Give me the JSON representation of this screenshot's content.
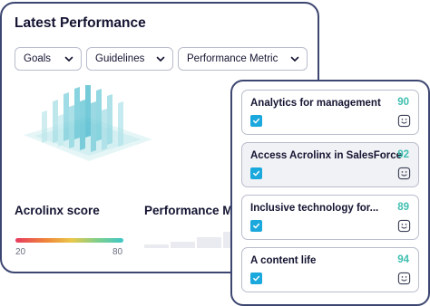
{
  "performance": {
    "title": "Latest Performance",
    "filters": [
      {
        "label": "Goals"
      },
      {
        "label": "Guidelines"
      },
      {
        "label": "Performance Metric"
      }
    ],
    "score": {
      "label": "Acrolinx score",
      "min": "20",
      "max": "80"
    },
    "metric_label": "Performance Me"
  },
  "items": [
    {
      "title": "Analytics for management",
      "score": "90",
      "checked": true
    },
    {
      "title": "Access Acrolinx in SalesForce",
      "score": "92",
      "checked": true
    },
    {
      "title": "Inclusive technology for...",
      "score": "89",
      "checked": true
    },
    {
      "title": "A content life",
      "score": "94",
      "checked": true
    }
  ],
  "colors": {
    "border": "#3c4670",
    "accent_teal": "#3fbfb0",
    "checkbox_blue": "#1ba8dc"
  }
}
